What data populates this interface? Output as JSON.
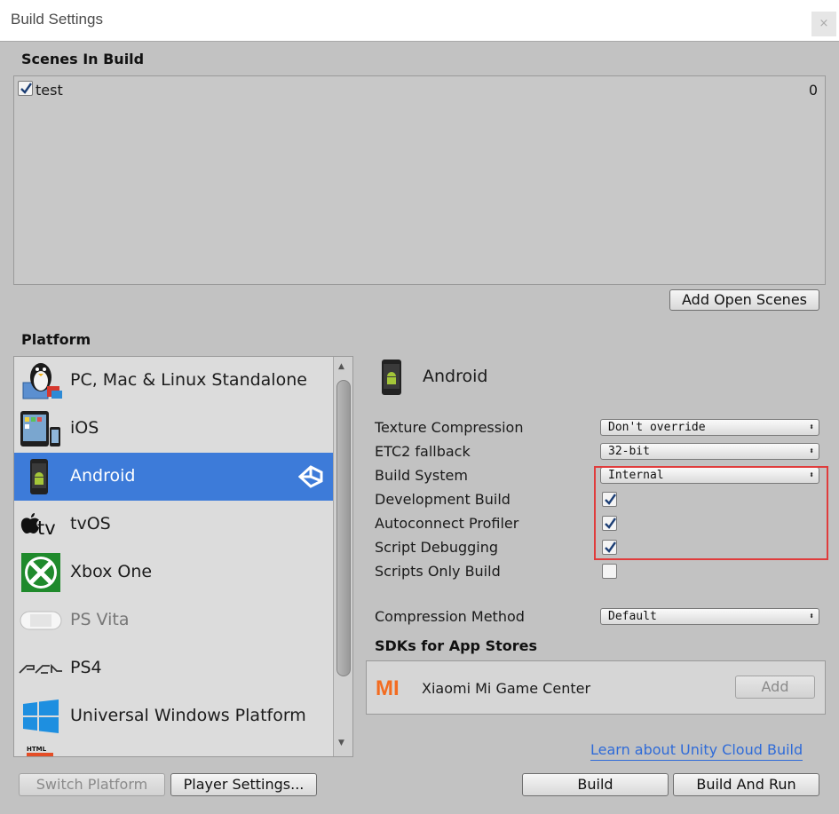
{
  "window": {
    "title": "Build Settings",
    "close_glyph": "×"
  },
  "scenes": {
    "header": "Scenes In Build",
    "items": [
      {
        "name": "test",
        "index": "0",
        "checked": true
      }
    ],
    "add_open_scenes": "Add Open Scenes"
  },
  "platform": {
    "header": "Platform",
    "items": [
      {
        "label": "PC, Mac & Linux Standalone",
        "icon": "linux-tux-icon"
      },
      {
        "label": "iOS",
        "icon": "ipad-iphone-icon"
      },
      {
        "label": "Android",
        "icon": "android-phone-icon",
        "selected": true
      },
      {
        "label": "tvOS",
        "icon": "apple-tv-icon"
      },
      {
        "label": "Xbox One",
        "icon": "xbox-icon"
      },
      {
        "label": "PS Vita",
        "icon": "ps-vita-icon"
      },
      {
        "label": "PS4",
        "icon": "ps4-logo-icon"
      },
      {
        "label": "Universal Windows Platform",
        "icon": "windows-icon"
      }
    ],
    "active_badge_icon": "unity-logo-icon"
  },
  "details": {
    "title": "Android",
    "texture_compression": {
      "label": "Texture Compression",
      "value": "Don't override"
    },
    "etc2_fallback": {
      "label": "ETC2 fallback",
      "value": "32-bit"
    },
    "build_system": {
      "label": "Build System",
      "value": "Internal"
    },
    "development_build": {
      "label": "Development Build",
      "checked": true
    },
    "autoconnect_profiler": {
      "label": "Autoconnect Profiler",
      "checked": true
    },
    "script_debugging": {
      "label": "Script Debugging",
      "checked": true
    },
    "scripts_only_build": {
      "label": "Scripts Only Build",
      "checked": false
    },
    "compression_method": {
      "label": "Compression Method",
      "value": "Default"
    },
    "sdks_header": "SDKs for App Stores",
    "sdk_item": {
      "name": "Xiaomi Mi Game Center",
      "logo": "MI",
      "add": "Add"
    },
    "cloud_link": "Learn about Unity Cloud Build"
  },
  "buttons": {
    "switch_platform": "Switch Platform",
    "player_settings": "Player Settings...",
    "build": "Build",
    "build_and_run": "Build And Run"
  },
  "colors": {
    "selection": "#3d7bd9",
    "highlight_box": "#e03c3c",
    "link": "#2f6bd8",
    "xiaomi": "#f36c21"
  }
}
